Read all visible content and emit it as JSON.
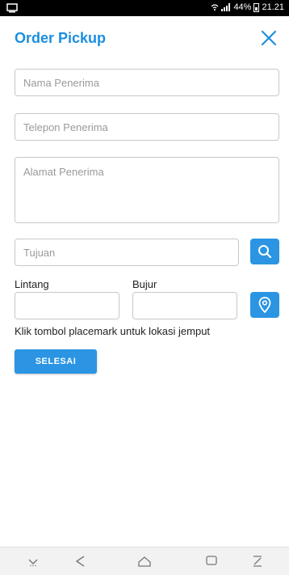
{
  "status_bar": {
    "battery": "44%",
    "time": "21.21"
  },
  "header": {
    "title": "Order Pickup"
  },
  "form": {
    "recipient_name_placeholder": "Nama Penerima",
    "recipient_phone_placeholder": "Telepon Penerima",
    "recipient_address_placeholder": "Alamat Penerima",
    "destination_placeholder": "Tujuan",
    "latitude_label": "Lintang",
    "longitude_label": "Bujur",
    "hint": "Klik tombol placemark untuk lokasi jemput",
    "submit_label": "SELESAI"
  },
  "colors": {
    "accent": "#2b95e3",
    "title": "#1b8fe0"
  },
  "icons": {
    "close": "close-icon",
    "search": "search-icon",
    "placemark": "map-pin-icon"
  }
}
